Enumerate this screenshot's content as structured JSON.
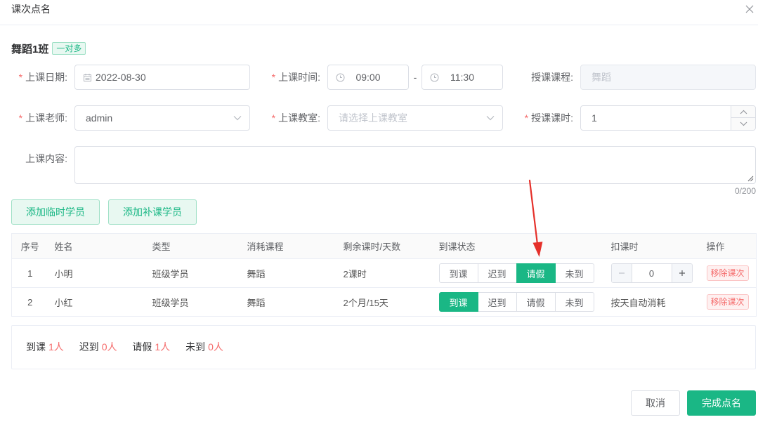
{
  "colors": {
    "accent": "#1ab785",
    "accent_light": "#e8f8f1",
    "accent_border": "#9fe0c6",
    "danger": "#f56c6c",
    "danger_light": "#fef0f0",
    "danger_border": "#fbc4c4",
    "annotation": "#e5302a"
  },
  "dialog": {
    "title": "课次点名",
    "close_icon": "close-icon"
  },
  "class_info": {
    "name": "舞蹈1班",
    "tag": "一对多"
  },
  "form": {
    "required_mark": "*",
    "date": {
      "label": "上课日期:",
      "value": "2022-08-30",
      "icon": "calendar-icon",
      "required": true
    },
    "time": {
      "label": "上课时间:",
      "start": "09:00",
      "separator": "-",
      "end": "11:30",
      "icon": "clock-icon",
      "required": true
    },
    "course": {
      "label": "授课课程:",
      "value": "舞蹈",
      "disabled": true,
      "required": false
    },
    "teacher": {
      "label": "上课老师:",
      "value": "admin",
      "icon": "chevron-down-icon",
      "required": true
    },
    "classroom": {
      "label": "上课教室:",
      "placeholder": "请选择上课教室",
      "icon": "chevron-down-icon",
      "required": true
    },
    "hours": {
      "label": "授课课时:",
      "value": "1",
      "icons": [
        "chevron-up-icon",
        "chevron-down-icon"
      ],
      "required": true
    },
    "content": {
      "label": "上课内容:",
      "counter": "0/200",
      "required": false
    }
  },
  "actions": {
    "add_temporary_student": "添加临时学员",
    "add_makeup_student": "添加补课学员"
  },
  "table": {
    "columns": [
      "序号",
      "姓名",
      "类型",
      "消耗课程",
      "剩余课时/天数",
      "到课状态",
      "扣课时",
      "操作"
    ],
    "rows": [
      {
        "index": "1",
        "name": "小明",
        "type": "班级学员",
        "course": "舞蹈",
        "remaining": "2课时",
        "status_buttons": [
          {
            "label": "到课",
            "selected": false
          },
          {
            "label": "迟到",
            "selected": false
          },
          {
            "label": "请假",
            "selected": true
          },
          {
            "label": "未到",
            "selected": false
          }
        ],
        "deduct": {
          "value": "0",
          "minus_icon": "minus-icon",
          "plus_icon": "plus-icon"
        },
        "action": "移除课次"
      },
      {
        "index": "2",
        "name": "小红",
        "type": "班级学员",
        "course": "舞蹈",
        "remaining": "2个月/15天",
        "status_buttons": [
          {
            "label": "到课",
            "selected": true
          },
          {
            "label": "迟到",
            "selected": false
          },
          {
            "label": "请假",
            "selected": false
          },
          {
            "label": "未到",
            "selected": false
          }
        ],
        "deduct_text": "按天自动消耗",
        "action": "移除课次"
      }
    ]
  },
  "summary": [
    {
      "label": "到课",
      "count": "1人"
    },
    {
      "label": "迟到",
      "count": "0人"
    },
    {
      "label": "请假",
      "count": "1人"
    },
    {
      "label": "未到",
      "count": "0人"
    }
  ],
  "footer": {
    "cancel": "取消",
    "confirm": "完成点名"
  }
}
